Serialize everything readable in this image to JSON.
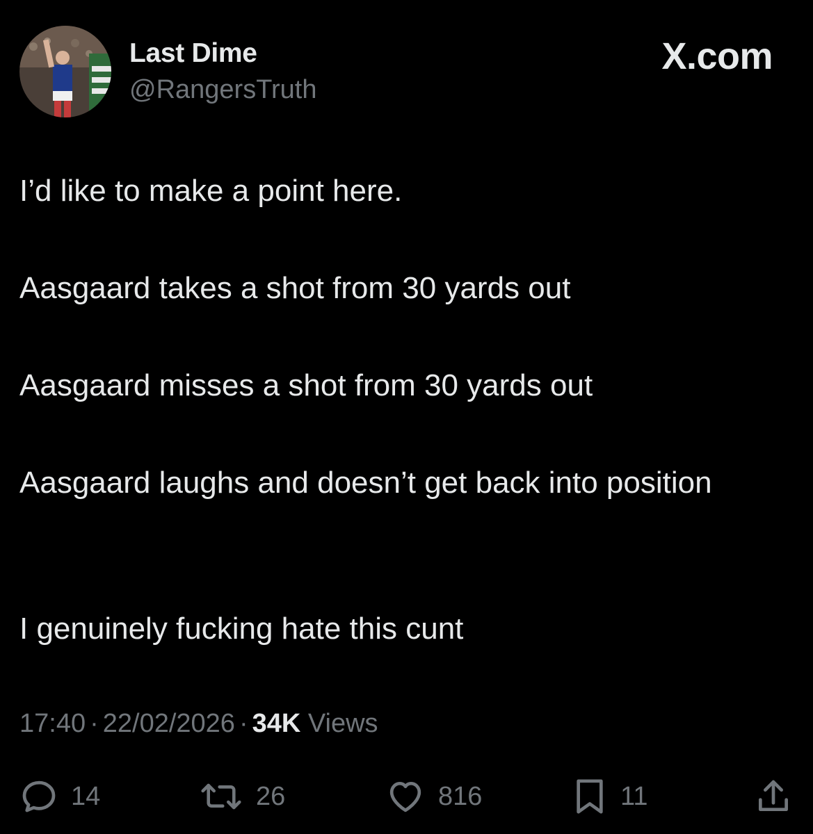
{
  "author": {
    "display_name": "Last Dime",
    "handle": "@RangersTruth"
  },
  "brand": "X.com",
  "tweet": {
    "paragraphs": [
      "I’d like to make a point here.",
      "Aasgaard takes a shot from 30 yards out",
      "Aasgaard misses a shot from 30 yards out",
      "Aasgaard laughs and doesn’t get back into position",
      "I genuinely fucking hate this cunt"
    ]
  },
  "meta": {
    "time": "17:40",
    "date": "22/02/2026",
    "views_count": "34K",
    "views_label": "Views",
    "separator": "·"
  },
  "actions": {
    "replies": "14",
    "retweets": "26",
    "likes": "816",
    "bookmarks": "11"
  },
  "icons": {
    "reply": "speech-bubble-icon",
    "retweet": "retweet-arrows-icon",
    "like": "heart-icon",
    "bookmark": "bookmark-icon",
    "share": "share-upload-icon"
  },
  "colors": {
    "background": "#000000",
    "primary_text": "#e7e9ea",
    "secondary_text": "#71767b"
  }
}
